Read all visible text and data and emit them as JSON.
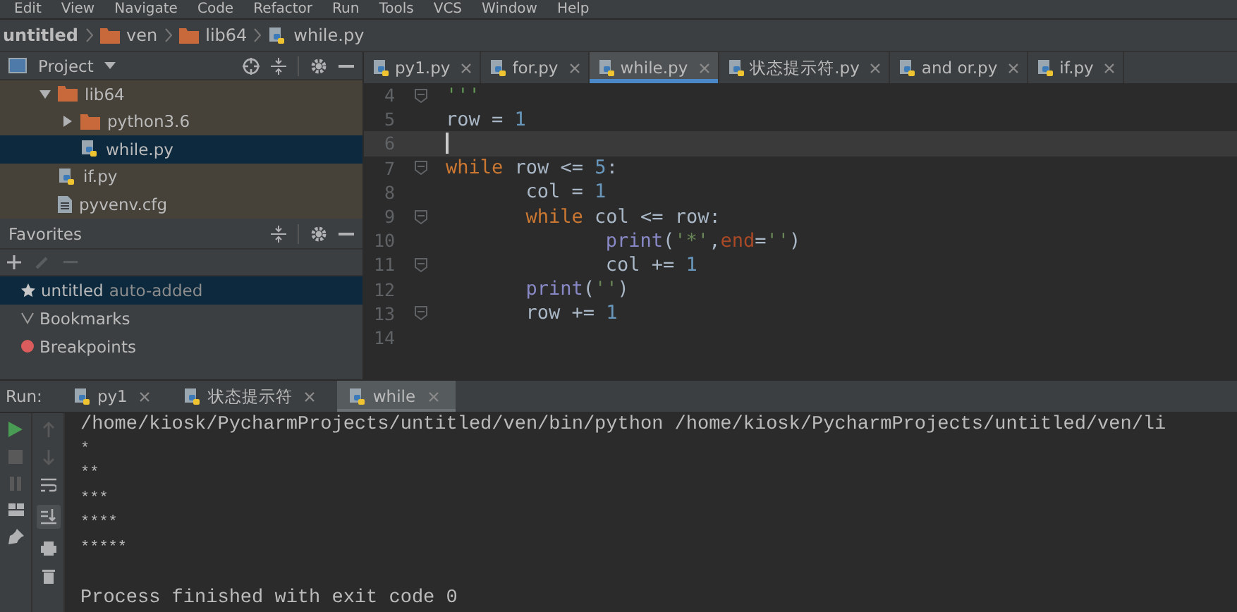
{
  "menu": [
    "Edit",
    "View",
    "Navigate",
    "Code",
    "Refactor",
    "Run",
    "Tools",
    "VCS",
    "Window",
    "Help"
  ],
  "breadcrumb": [
    {
      "label": "untitled",
      "kind": "project"
    },
    {
      "label": "ven",
      "kind": "folder"
    },
    {
      "label": "lib64",
      "kind": "folder"
    },
    {
      "label": "while.py",
      "kind": "python"
    }
  ],
  "project_panel": {
    "title": "Project",
    "tree": [
      {
        "label": "lib64",
        "kind": "folder",
        "expanded": true,
        "selected": false,
        "children": [
          {
            "label": "python3.6",
            "kind": "folder",
            "expanded": false,
            "selected": false
          },
          {
            "label": "while.py",
            "kind": "python",
            "selected": true
          }
        ]
      },
      {
        "label": "if.py",
        "kind": "python",
        "selected": false
      },
      {
        "label": "pyvenv.cfg",
        "kind": "text",
        "selected": false
      }
    ]
  },
  "favorites_panel": {
    "title": "Favorites",
    "items": [
      {
        "label": "untitled",
        "note": "auto-added",
        "kind": "star",
        "selected": true
      },
      {
        "label": "Bookmarks",
        "kind": "check",
        "selected": false
      },
      {
        "label": "Breakpoints",
        "kind": "breakpoint",
        "selected": false
      }
    ]
  },
  "editor_tabs": [
    {
      "label": "py1.py",
      "selected": false
    },
    {
      "label": "for.py",
      "selected": false
    },
    {
      "label": "while.py",
      "selected": true
    },
    {
      "label": "状态提示符.py",
      "selected": false
    },
    {
      "label": "and or.py",
      "selected": false
    },
    {
      "label": "if.py",
      "selected": false
    }
  ],
  "editor": {
    "lines": [
      {
        "number": "4",
        "fold": true,
        "current": false,
        "tokens": [
          {
            "text": "'''",
            "kind": "doc"
          }
        ]
      },
      {
        "number": "5",
        "fold": false,
        "current": false,
        "tokens": [
          {
            "text": "row = ",
            "kind": "plain"
          },
          {
            "text": "1",
            "kind": "num"
          }
        ]
      },
      {
        "number": "6",
        "fold": false,
        "current": true
      },
      {
        "number": "7",
        "fold": true,
        "current": false,
        "tokens": [
          {
            "text": "while",
            "kind": "kw"
          },
          {
            "text": " row <= ",
            "kind": "plain"
          },
          {
            "text": "5",
            "kind": "num"
          },
          {
            "text": ":",
            "kind": "plain"
          }
        ],
        "children": [
          {
            "number": "8",
            "fold": false,
            "current": false,
            "tokens": [
              {
                "text": "col = ",
                "kind": "plain"
              },
              {
                "text": "1",
                "kind": "num"
              }
            ]
          },
          {
            "number": "9",
            "fold": true,
            "current": false,
            "tokens": [
              {
                "text": "while",
                "kind": "kw"
              },
              {
                "text": " col <= row:",
                "kind": "plain"
              }
            ],
            "children": [
              {
                "number": "10",
                "fold": false,
                "current": false,
                "tokens": [
                  {
                    "text": "print",
                    "kind": "builtin"
                  },
                  {
                    "text": "(",
                    "kind": "plain"
                  },
                  {
                    "text": "'*'",
                    "kind": "str"
                  },
                  {
                    "text": ",",
                    "kind": "plain"
                  },
                  {
                    "text": "end",
                    "kind": "param"
                  },
                  {
                    "text": "=",
                    "kind": "plain"
                  },
                  {
                    "text": "''",
                    "kind": "str"
                  },
                  {
                    "text": ")",
                    "kind": "plain"
                  }
                ]
              },
              {
                "number": "11",
                "fold": true,
                "current": false,
                "tokens": [
                  {
                    "text": "col += ",
                    "kind": "plain"
                  },
                  {
                    "text": "1",
                    "kind": "num"
                  }
                ]
              }
            ]
          },
          {
            "number": "12",
            "fold": false,
            "current": false,
            "tokens": [
              {
                "text": "print",
                "kind": "builtin"
              },
              {
                "text": "(",
                "kind": "plain"
              },
              {
                "text": "''",
                "kind": "str"
              },
              {
                "text": ")",
                "kind": "plain"
              }
            ]
          },
          {
            "number": "13",
            "fold": true,
            "current": false,
            "tokens": [
              {
                "text": "row += ",
                "kind": "plain"
              },
              {
                "text": "1",
                "kind": "num"
              }
            ]
          }
        ]
      },
      {
        "number": "14",
        "fold": false,
        "current": false
      }
    ]
  },
  "run_panel": {
    "label": "Run:",
    "tabs": [
      {
        "label": "py1",
        "selected": false
      },
      {
        "label": "状态提示符",
        "selected": false
      },
      {
        "label": "while",
        "selected": true
      }
    ],
    "console": [
      {
        "text": "/home/kiosk/PycharmProjects/untitled/ven/bin/python /home/kiosk/PycharmProjects/untitled/ven/li",
        "kind": "command"
      },
      {
        "text": "*",
        "kind": "output"
      },
      {
        "text": "**",
        "kind": "output"
      },
      {
        "text": "***",
        "kind": "output"
      },
      {
        "text": "****",
        "kind": "output"
      },
      {
        "text": "*****",
        "kind": "output"
      },
      {
        "kind": "blank"
      },
      {
        "text": "Process finished with exit code 0",
        "kind": "status"
      }
    ]
  }
}
